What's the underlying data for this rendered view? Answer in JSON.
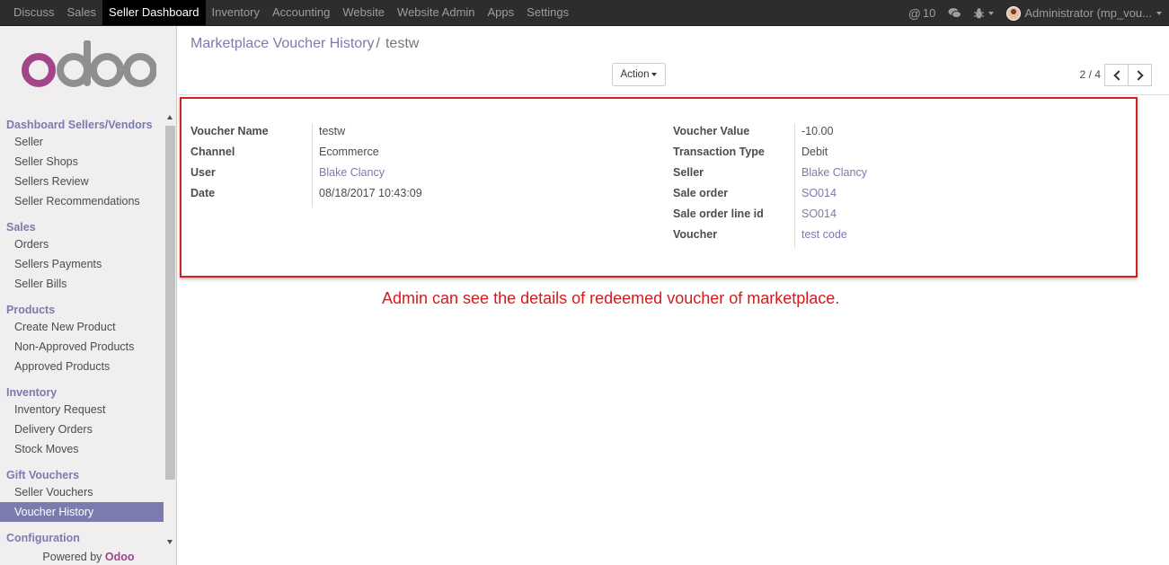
{
  "topbar": {
    "menu": [
      "Discuss",
      "Sales",
      "Seller Dashboard",
      "Inventory",
      "Accounting",
      "Website",
      "Website Admin",
      "Apps",
      "Settings"
    ],
    "active": "Seller Dashboard",
    "messages_count": "10",
    "user": "Administrator (mp_vou..."
  },
  "sidebar": {
    "sections": [
      {
        "title": "Dashboard Sellers/Vendors",
        "items": [
          "Seller",
          "Seller Shops",
          "Sellers Review",
          "Seller Recommendations"
        ]
      },
      {
        "title": "Sales",
        "items": [
          "Orders",
          "Sellers Payments",
          "Seller Bills"
        ]
      },
      {
        "title": "Products",
        "items": [
          "Create New Product",
          "Non-Approved Products",
          "Approved Products"
        ]
      },
      {
        "title": "Inventory",
        "items": [
          "Inventory Request",
          "Delivery Orders",
          "Stock Moves"
        ]
      },
      {
        "title": "Gift Vouchers",
        "items": [
          "Seller Vouchers",
          "Voucher History"
        ]
      },
      {
        "title": "Configuration",
        "items": []
      }
    ],
    "active_item": "Voucher History",
    "powered_prefix": "Powered by",
    "powered_brand": "Odoo"
  },
  "control_panel": {
    "breadcrumb_parent": "Marketplace Voucher History",
    "breadcrumb_sep": "/",
    "breadcrumb_current": "testw",
    "action_label": "Action",
    "pager": "2 / 4"
  },
  "form": {
    "left": [
      {
        "label": "Voucher Name",
        "value": "testw",
        "link": false
      },
      {
        "label": "Channel",
        "value": "Ecommerce",
        "link": false
      },
      {
        "label": "User",
        "value": "Blake Clancy",
        "link": true
      },
      {
        "label": "Date",
        "value": "08/18/2017 10:43:09",
        "link": false
      }
    ],
    "right": [
      {
        "label": "Voucher Value",
        "value": "-10.00",
        "link": false
      },
      {
        "label": "Transaction Type",
        "value": "Debit",
        "link": false
      },
      {
        "label": "Seller",
        "value": "Blake Clancy",
        "link": true
      },
      {
        "label": "Sale order",
        "value": "SO014",
        "link": true
      },
      {
        "label": "Sale order line id",
        "value": "SO014",
        "link": true
      },
      {
        "label": "Voucher",
        "value": "test code",
        "link": true
      }
    ]
  },
  "annotation": "Admin can see the details of redeemed voucher of marketplace.",
  "colors": {
    "accent": "#7c7bad",
    "brand": "#a24689",
    "annotation": "#d71a1a"
  }
}
